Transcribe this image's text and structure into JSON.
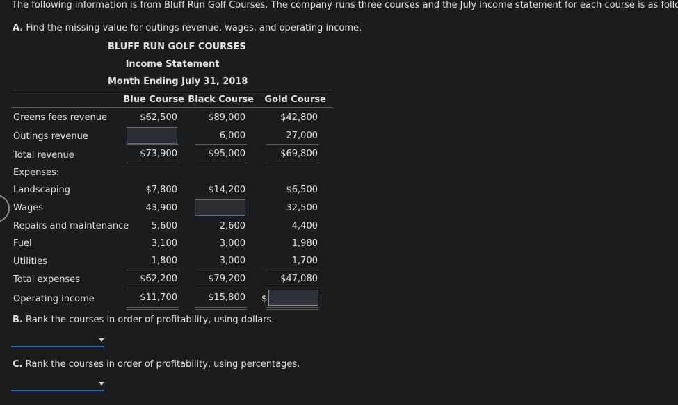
{
  "intro": "The following information is from Bluff Run Golf Courses. The company runs three courses and the July income statement for each course is as follows:",
  "question_a": {
    "label": "A.",
    "text": "Find the missing value for outings revenue, wages, and operating income."
  },
  "statement": {
    "company": "BLUFF RUN GOLF COURSES",
    "title": "Income Statement",
    "period": "Month Ending July 31, 2018"
  },
  "columns": [
    "Blue Course",
    "Black Course",
    "Gold Course"
  ],
  "rows": {
    "greens": {
      "label": "Greens fees revenue",
      "values": [
        "$62,500",
        "$89,000",
        "$42,800"
      ]
    },
    "outings": {
      "label": "Outings revenue",
      "values": [
        "",
        "6,000",
        "27,000"
      ]
    },
    "total_revenue": {
      "label": "Total revenue",
      "values": [
        "$73,900",
        "$95,000",
        "$69,800"
      ]
    },
    "expenses": {
      "label": "Expenses:"
    },
    "landscaping": {
      "label": "Landscaping",
      "values": [
        "$7,800",
        "$14,200",
        "$6,500"
      ]
    },
    "wages": {
      "label": "Wages",
      "values": [
        "43,900",
        "",
        "32,500"
      ]
    },
    "repairs": {
      "label": "Repairs and maintenance",
      "values": [
        "5,600",
        "2,600",
        "4,400"
      ]
    },
    "fuel": {
      "label": "Fuel",
      "values": [
        "3,100",
        "3,000",
        "1,980"
      ]
    },
    "utilities": {
      "label": "Utilities",
      "values": [
        "1,800",
        "3,000",
        "1,700"
      ]
    },
    "total_expenses": {
      "label": "Total expenses",
      "values": [
        "$62,200",
        "$79,200",
        "$47,080"
      ]
    },
    "operating_income": {
      "label": "Operating income",
      "values": [
        "$11,700",
        "$15,800",
        ""
      ],
      "gold_prefix": "$"
    }
  },
  "question_b": {
    "label": "B.",
    "text": "Rank the courses in order of profitability, using dollars."
  },
  "question_c": {
    "label": "C.",
    "text": "Rank the courses in order of profitability, using percentages."
  },
  "select_b": {
    "selected": ""
  },
  "select_c": {
    "selected": ""
  }
}
